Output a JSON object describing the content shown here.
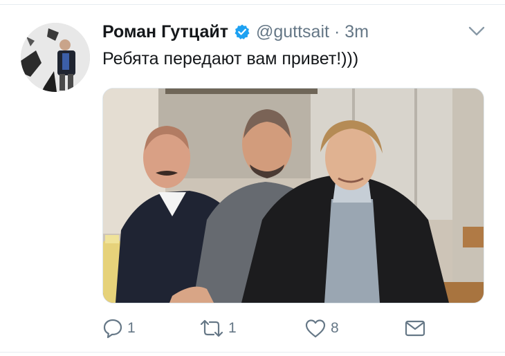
{
  "tweet": {
    "author_name": "Роман Гутцайт",
    "handle": "@guttsait",
    "separator": "·",
    "timestamp": "3m",
    "text": "Ребята передают вам привет!)))",
    "verified": true,
    "icons": {
      "verified": "verified-badge-icon",
      "more": "chevron-down-icon"
    }
  },
  "actions": {
    "reply_count": "1",
    "retweet_count": "1",
    "like_count": "8",
    "icons": [
      "reply-icon",
      "retweet-icon",
      "like-icon",
      "direct-message-icon"
    ]
  },
  "colors": {
    "name_text": "#14171a",
    "secondary_text": "#657786",
    "verified_blue": "#1da1f2",
    "divider": "#e6ecf0"
  }
}
